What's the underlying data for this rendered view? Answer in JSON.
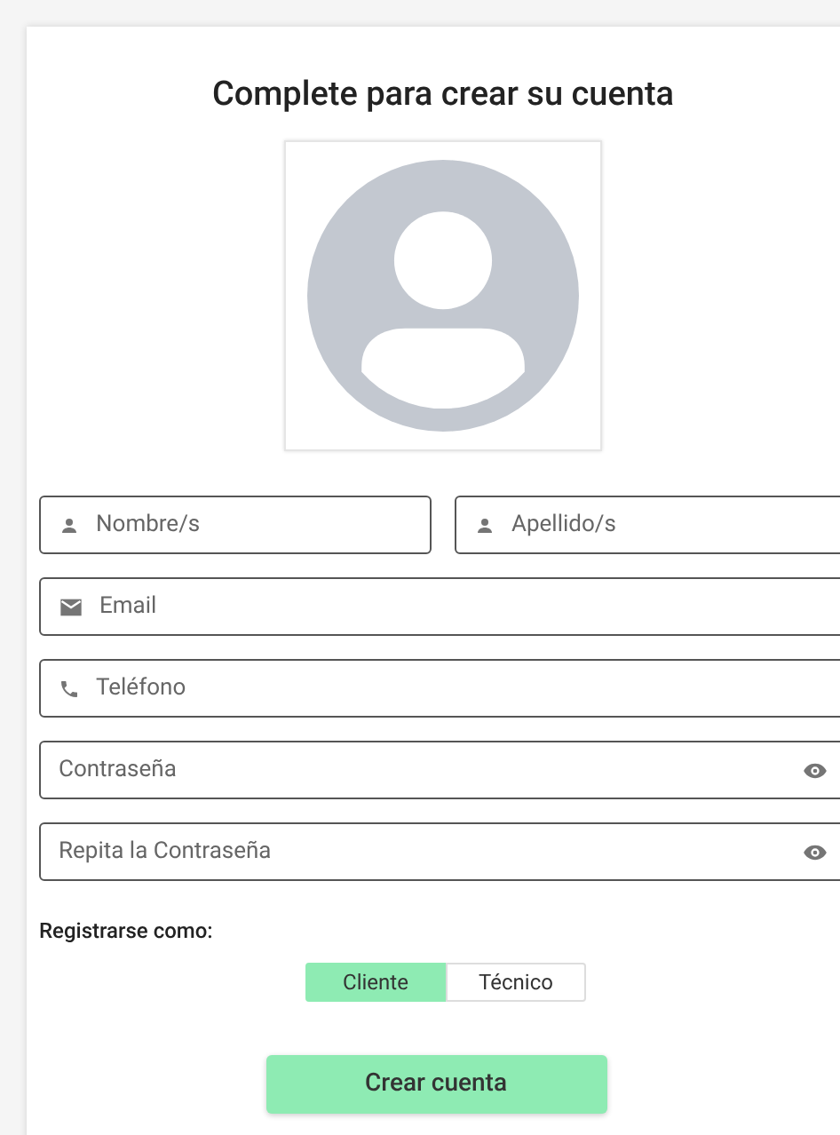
{
  "title": "Complete para crear su cuenta",
  "avatar": {
    "kind": "placeholder"
  },
  "name_fields": [
    {
      "kind": "person",
      "placeholder": "Nombre/s"
    },
    {
      "kind": "person",
      "placeholder": "Apellido/s"
    }
  ],
  "fields": [
    {
      "kind": "email",
      "placeholder": "Email"
    },
    {
      "kind": "phone",
      "placeholder": "Teléfono"
    },
    {
      "kind": "password",
      "placeholder": "Contraseña"
    },
    {
      "kind": "password",
      "placeholder": "Repita la Contraseña"
    }
  ],
  "role": {
    "label": "Registrarse como:",
    "options": [
      {
        "label": "Cliente",
        "selected": true
      },
      {
        "label": "Técnico",
        "selected": false
      }
    ]
  },
  "submit": "Crear cuenta"
}
